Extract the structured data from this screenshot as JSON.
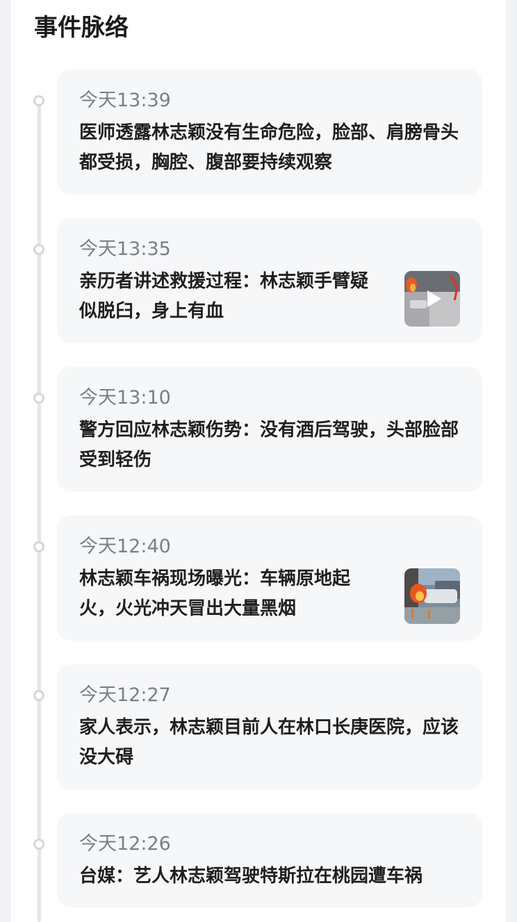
{
  "section_title": "事件脉络",
  "events": [
    {
      "time": "今天13:39",
      "text": "医师透露林志颖没有生命危险，脸部、肩膀骨头都受损，胸腔、腹部要持续观察"
    },
    {
      "time": "今天13:35",
      "text": "亲历者讲述救援过程：林志颖手臂疑似脱臼，身上有血",
      "thumbnail": "video-thumbnail",
      "thumbnail_icon": "play-icon"
    },
    {
      "time": "今天13:10",
      "text": "警方回应林志颖伤势：没有酒后驾驶，头部脸部受到轻伤"
    },
    {
      "time": "今天12:40",
      "text": "林志颖车祸现场曝光：车辆原地起火，火光冲天冒出大量黑烟",
      "thumbnail": "image-thumbnail"
    },
    {
      "time": "今天12:27",
      "text": "家人表示，林志颖目前人在林口长庚医院，应该没大碍"
    },
    {
      "time": "今天12:26",
      "text": "台媒：艺人林志颖驾驶特斯拉在桃园遭车祸"
    }
  ],
  "colors": {
    "card_bg": "#f6f7f9",
    "time_text": "#7b7e86",
    "body_text": "#1f1f1f",
    "timeline": "#e4e6ea"
  }
}
